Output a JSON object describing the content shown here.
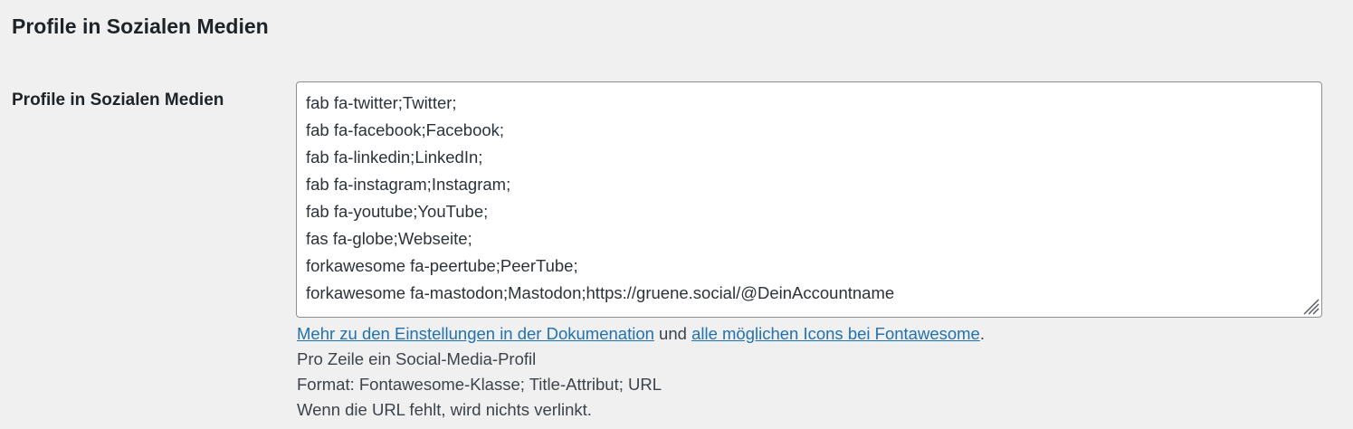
{
  "section": {
    "title": "Profile in Sozialen Medien"
  },
  "field": {
    "label": "Profile in Sozialen Medien",
    "lines": [
      "fab fa-twitter;Twitter;",
      "fab fa-facebook;Facebook;",
      "fab fa-linkedin;LinkedIn;",
      "fab fa-instagram;Instagram;",
      "fab fa-youtube;YouTube;",
      "fas fa-globe;Webseite;",
      "forkawesome fa-peertube;PeerTube;",
      "forkawesome fa-mastodon;Mastodon;https://gruene.social/@DeinAccountname"
    ],
    "resize_icon": "resize-grip-icon"
  },
  "description": {
    "link_docs": "Mehr zu den Einstellungen in der Dokumenation",
    "connector": " und ",
    "link_icons": "alle möglichen Icons bei Fontawesome",
    "end_punct": ".",
    "line1": "Pro Zeile ein Social-Media-Profil",
    "line2": "Format: Fontawesome-Klasse; Title-Attribut; URL",
    "line3": "Wenn die URL fehlt, wird nichts verlinkt."
  },
  "colors": {
    "background": "#f0f0f1",
    "link": "#2271b1",
    "text": "#1d2327",
    "border": "#8c8f94"
  }
}
